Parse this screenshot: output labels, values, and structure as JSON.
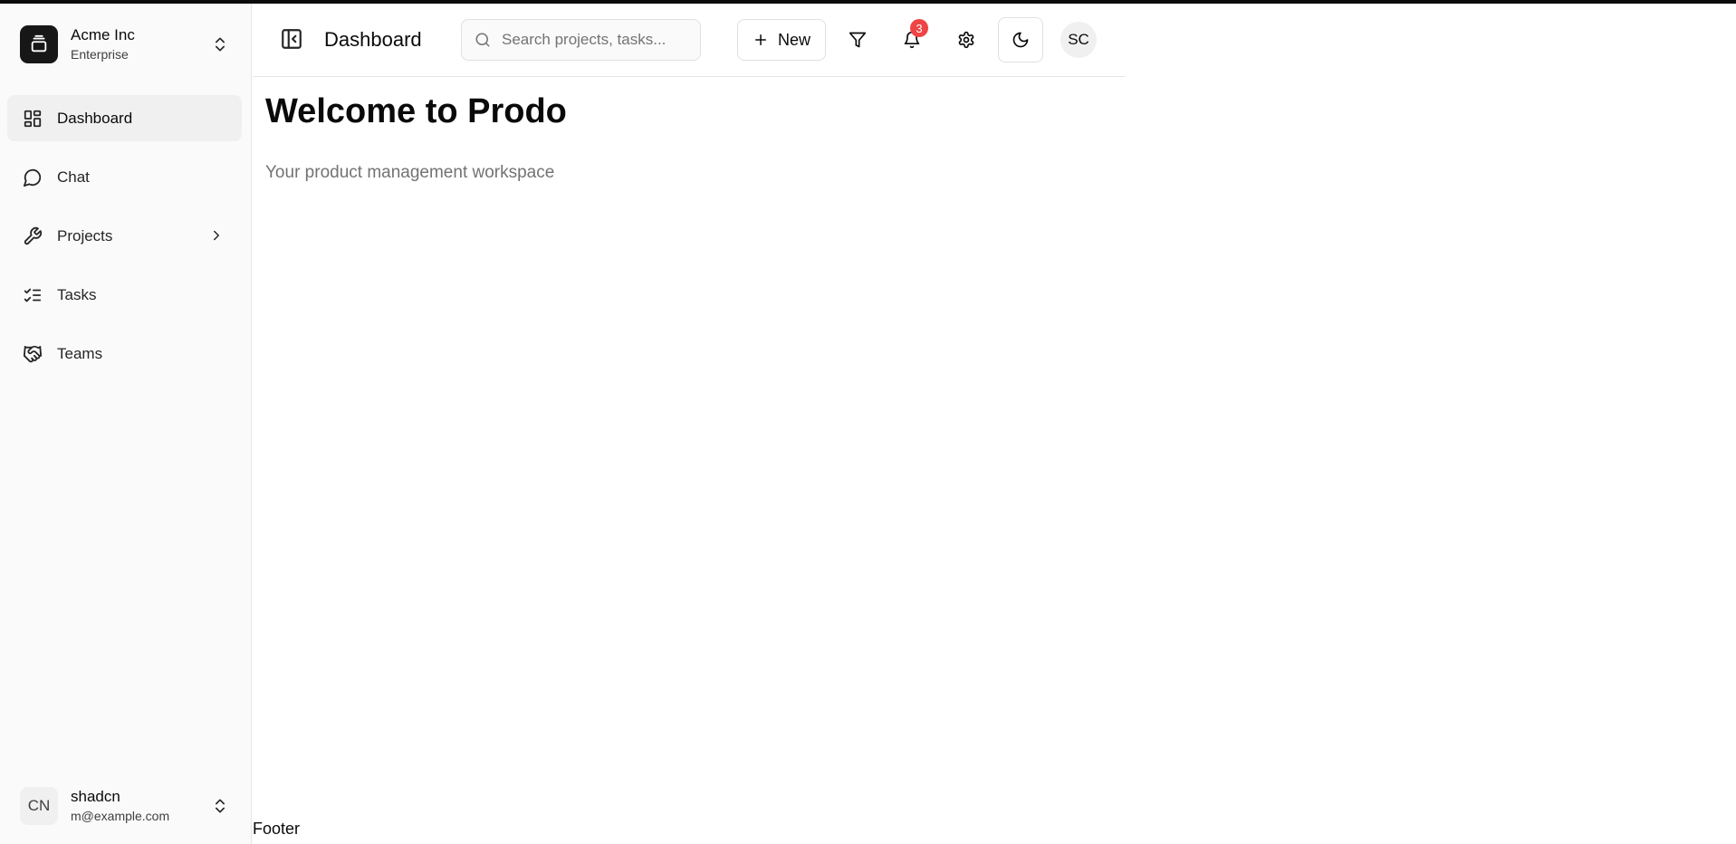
{
  "team": {
    "name": "Acme Inc",
    "plan": "Enterprise"
  },
  "nav": {
    "items": [
      {
        "label": "Dashboard",
        "icon": "layout-dashboard-icon",
        "active": true
      },
      {
        "label": "Chat",
        "icon": "message-circle-icon"
      },
      {
        "label": "Projects",
        "icon": "wrench-icon",
        "has_submenu": true
      },
      {
        "label": "Tasks",
        "icon": "list-checks-icon"
      },
      {
        "label": "Teams",
        "icon": "handshake-icon"
      }
    ]
  },
  "user": {
    "initials": "CN",
    "name": "shadcn",
    "email": "m@example.com"
  },
  "header": {
    "title": "Dashboard",
    "search_placeholder": "Search projects, tasks...",
    "new_label": "New",
    "notification_count": "3",
    "avatar_initials": "SC"
  },
  "main": {
    "title": "Welcome to Prodo",
    "subtitle": "Your product management workspace"
  },
  "footer": {
    "text": "Footer"
  },
  "colors": {
    "accent_dark": "#171717",
    "badge": "#ef4444",
    "muted_text": "#737373",
    "sidebar_bg": "#fafafa",
    "active_bg": "#f0f0f0"
  }
}
